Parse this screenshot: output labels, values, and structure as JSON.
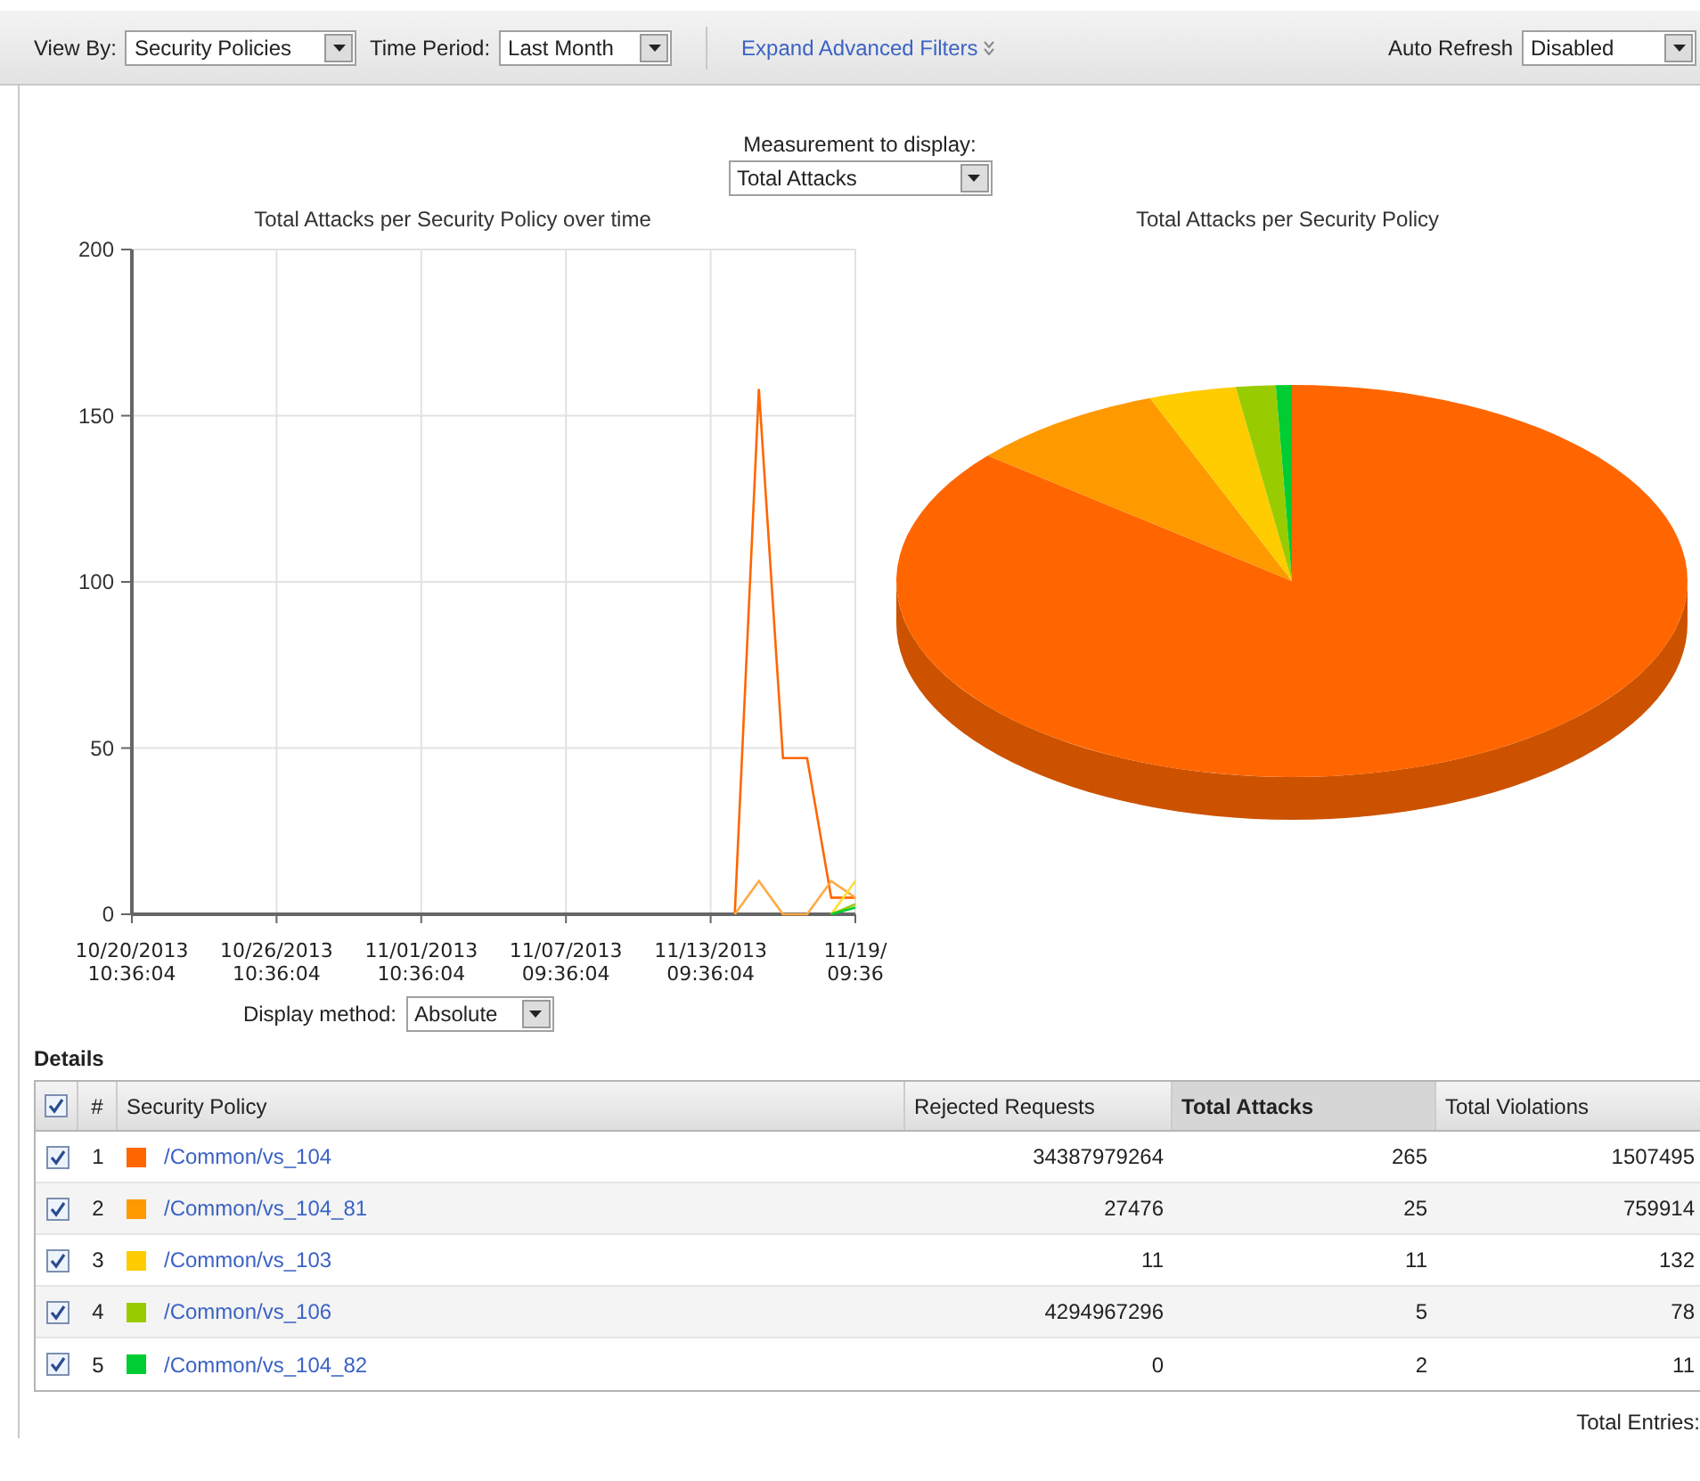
{
  "toolbar": {
    "view_by": {
      "label": "View By:",
      "value": "Security Policies"
    },
    "time_period": {
      "label": "Time Period:",
      "value": "Last Month"
    },
    "expand_link": "Expand Advanced Filters",
    "auto_refresh": {
      "label": "Auto Refresh",
      "value": "Disabled"
    }
  },
  "measurement": {
    "label": "Measurement to display:",
    "value": "Total Attacks"
  },
  "line_chart": {
    "chart_data": {
      "type": "line",
      "grid": true,
      "title": "Total Attacks per Security Policy over time",
      "ylim": [
        0,
        200
      ],
      "yticks": [
        0,
        50,
        100,
        150,
        200
      ],
      "categories": [
        "10/20/2013 10:36:04",
        null,
        null,
        null,
        null,
        null,
        "10/26/2013 10:36:04",
        null,
        null,
        null,
        null,
        null,
        "11/01/2013 10:36:04",
        null,
        null,
        null,
        null,
        null,
        "11/07/2013 09:36:04",
        null,
        null,
        null,
        null,
        null,
        "11/13/2013 09:36:04",
        null,
        null,
        null,
        null,
        null,
        "11/19/ 09:36"
      ],
      "series": [
        {
          "color": "#ff6600",
          "values": [
            null,
            null,
            null,
            null,
            null,
            null,
            null,
            null,
            null,
            null,
            null,
            null,
            null,
            null,
            null,
            null,
            null,
            null,
            null,
            null,
            null,
            null,
            null,
            null,
            null,
            0,
            158,
            47,
            47,
            5,
            5
          ]
        },
        {
          "color": "#ffaa44",
          "values": [
            null,
            null,
            null,
            null,
            null,
            null,
            null,
            null,
            null,
            null,
            null,
            null,
            null,
            null,
            null,
            null,
            null,
            null,
            null,
            null,
            null,
            null,
            null,
            null,
            null,
            0,
            10,
            0,
            0,
            10,
            5
          ]
        },
        {
          "color": "#ffdd33",
          "values": [
            null,
            null,
            null,
            null,
            null,
            null,
            null,
            null,
            null,
            null,
            null,
            null,
            null,
            null,
            null,
            null,
            null,
            null,
            null,
            null,
            null,
            null,
            null,
            null,
            null,
            null,
            null,
            null,
            null,
            0,
            10
          ]
        },
        {
          "color": "#99cc00",
          "values": [
            null,
            null,
            null,
            null,
            null,
            null,
            null,
            null,
            null,
            null,
            null,
            null,
            null,
            null,
            null,
            null,
            null,
            null,
            null,
            null,
            null,
            null,
            null,
            null,
            null,
            null,
            null,
            null,
            null,
            0,
            3
          ]
        },
        {
          "color": "#00cc33",
          "values": [
            null,
            null,
            null,
            null,
            null,
            null,
            null,
            null,
            null,
            null,
            null,
            null,
            null,
            null,
            null,
            null,
            null,
            null,
            null,
            null,
            null,
            null,
            null,
            null,
            null,
            null,
            null,
            null,
            null,
            0,
            2
          ]
        }
      ]
    }
  },
  "display_method": {
    "label": "Display method:",
    "value": "Absolute"
  },
  "pie_chart": {
    "title": "Total Attacks per Security Policy"
  },
  "details": {
    "title": "Details",
    "header_checked": true,
    "columns": [
      {
        "label": "#",
        "sorted": false
      },
      {
        "label": "Security Policy",
        "sorted": false
      },
      {
        "label": "Rejected Requests",
        "sorted": false
      },
      {
        "label": "Total Attacks",
        "sorted": true
      },
      {
        "label": "Total Violations",
        "sorted": false
      }
    ],
    "rows": [
      {
        "checked": true,
        "number": "1",
        "color": "#ff6600",
        "policy": "/Common/vs_104",
        "rejected_requests": "34387979264",
        "total_attacks": "265",
        "total_violations": "1507495"
      },
      {
        "checked": true,
        "number": "2",
        "color": "#ff9900",
        "policy": "/Common/vs_104_81",
        "rejected_requests": "27476",
        "total_attacks": "25",
        "total_violations": "759914"
      },
      {
        "checked": true,
        "number": "3",
        "color": "#ffcc00",
        "policy": "/Common/vs_103",
        "rejected_requests": "11",
        "total_attacks": "11",
        "total_violations": "132"
      },
      {
        "checked": true,
        "number": "4",
        "color": "#99cc00",
        "policy": "/Common/vs_106",
        "rejected_requests": "4294967296",
        "total_attacks": "5",
        "total_violations": "78"
      },
      {
        "checked": true,
        "number": "5",
        "color": "#00cc33",
        "policy": "/Common/vs_104_82",
        "rejected_requests": "0",
        "total_attacks": "2",
        "total_violations": "11"
      }
    ],
    "total": "Total Entries:"
  }
}
